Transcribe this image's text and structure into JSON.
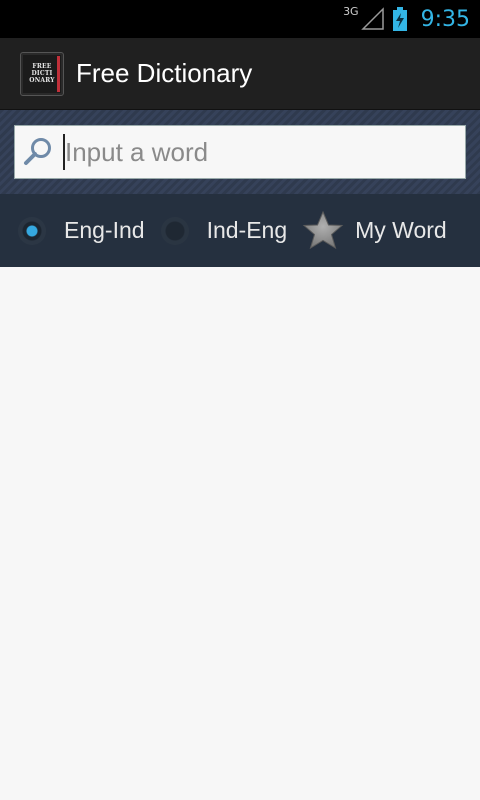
{
  "status_bar": {
    "network": "3G",
    "time": "9:35",
    "icons": [
      "signal-icon",
      "battery-charging-icon"
    ]
  },
  "action_bar": {
    "app_icon_text": "FREE DICTI ONARY",
    "title": "Free Dictionary"
  },
  "search": {
    "placeholder": "Input a word",
    "value": ""
  },
  "options": {
    "eng_ind": "Eng-Ind",
    "ind_eng": "Ind-Eng",
    "my_word": "My Word",
    "selected": "Eng-Ind"
  },
  "colors": {
    "accent": "#33b5e5",
    "action_bar": "#202020",
    "search_bg": "#2f3a4e",
    "options_bg": "#25303f"
  }
}
